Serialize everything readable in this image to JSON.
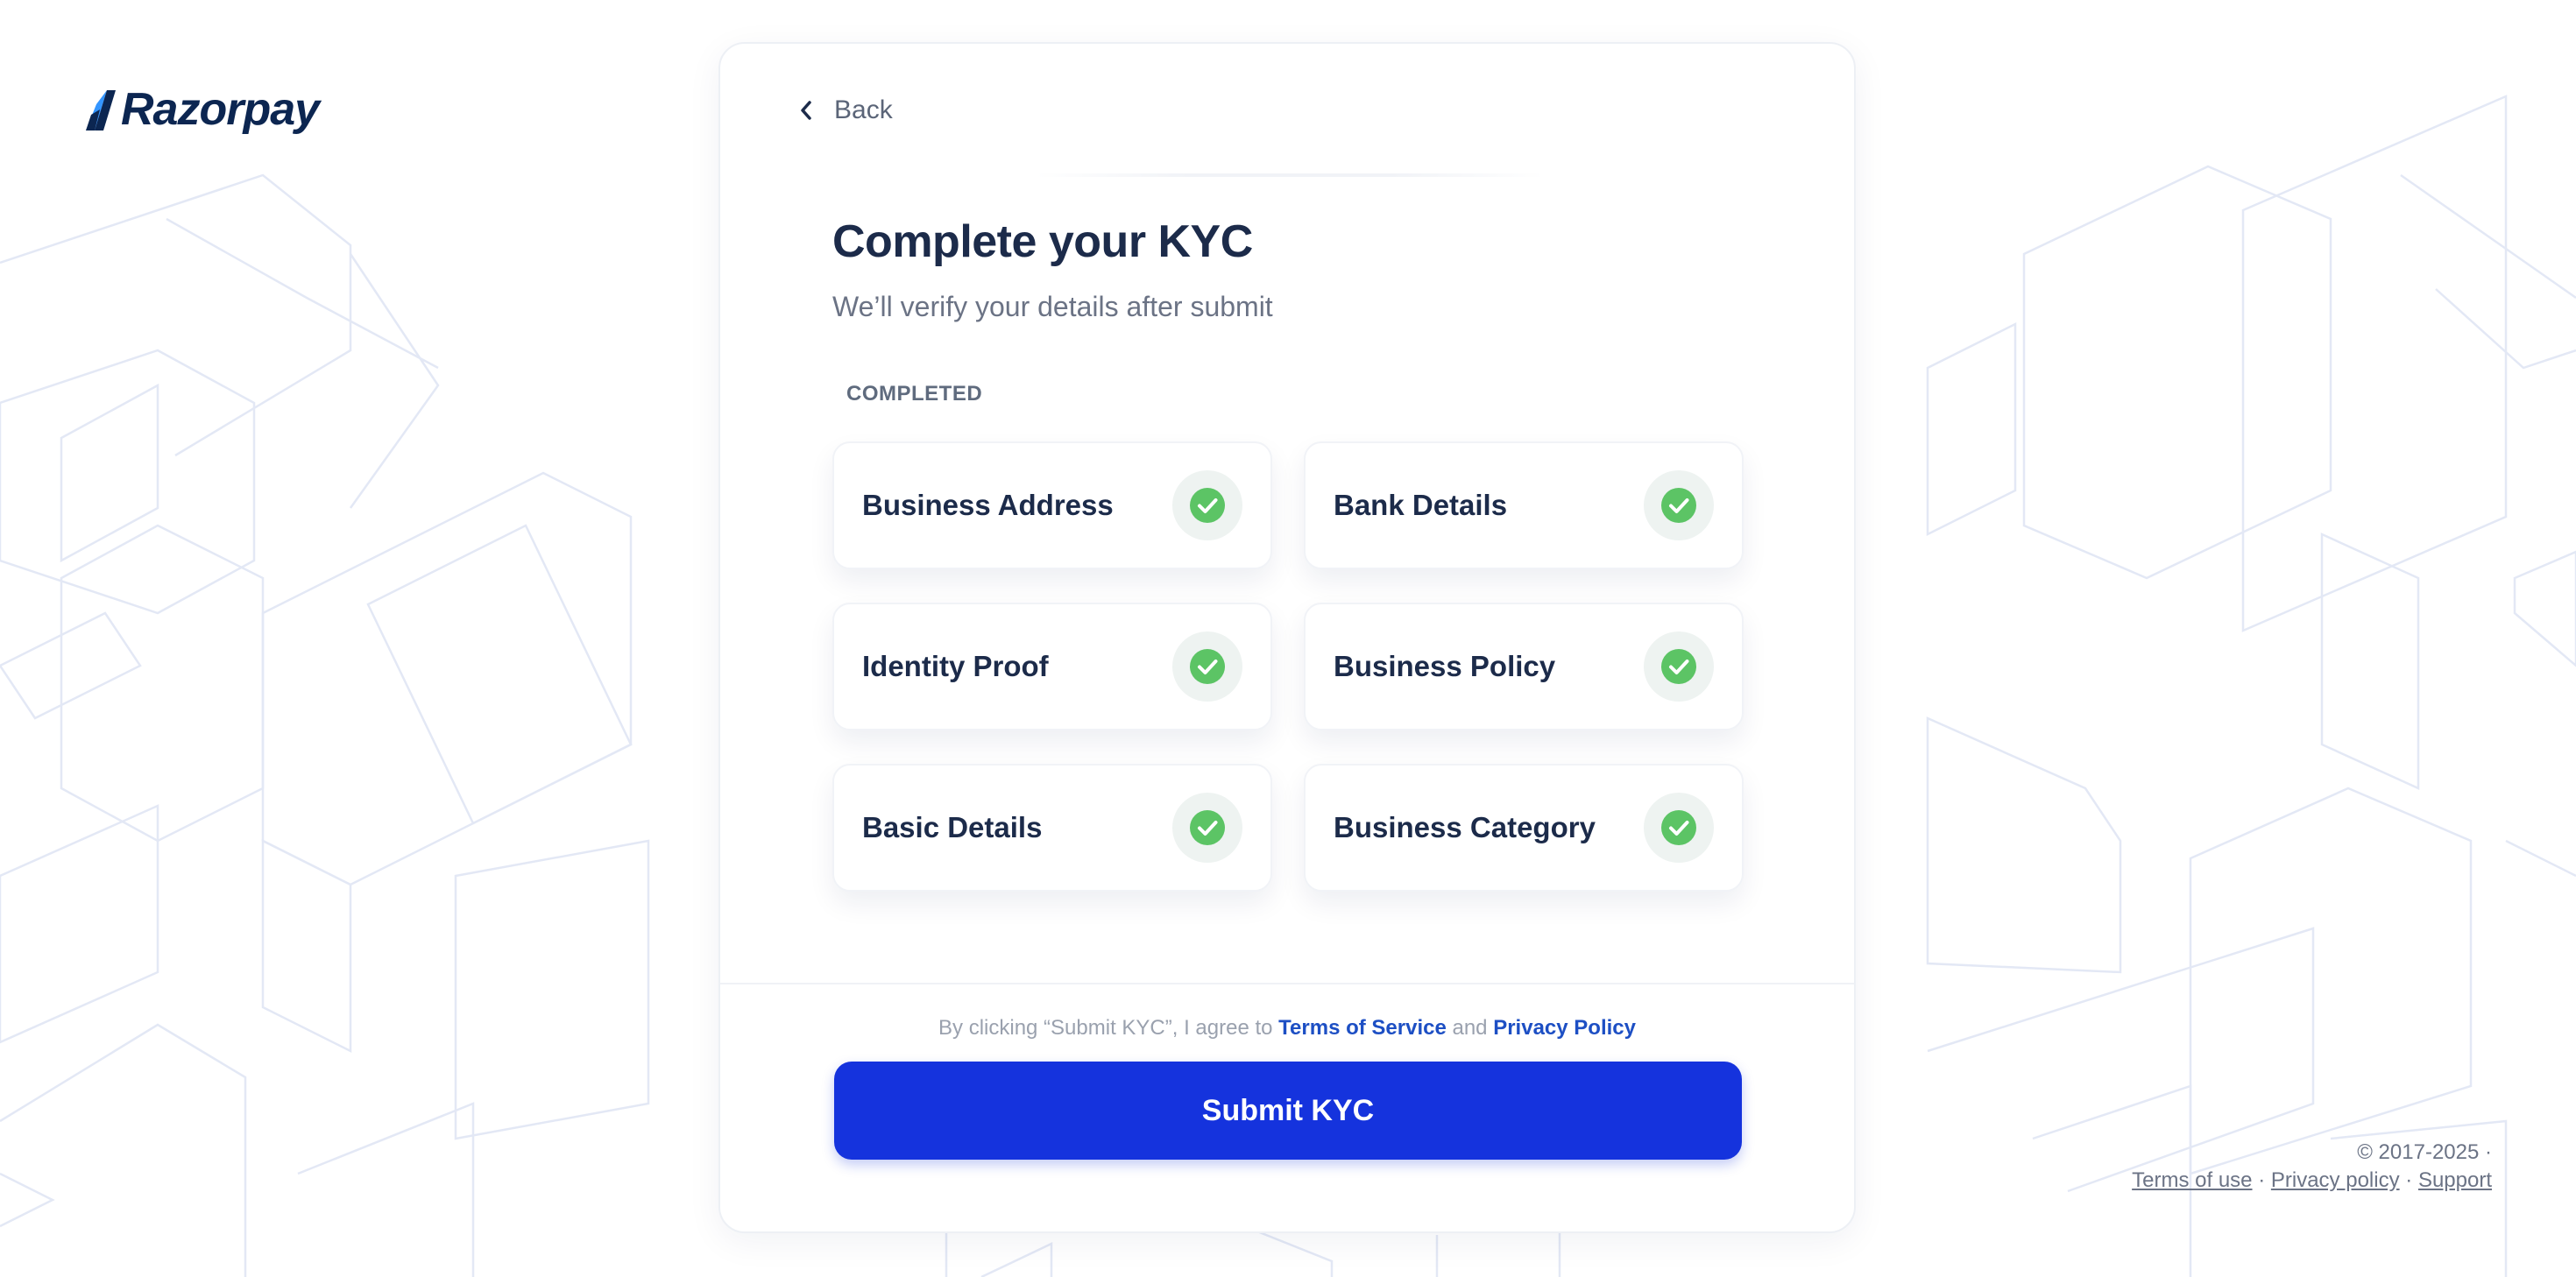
{
  "brand": {
    "name": "Razorpay",
    "color": "#0c2651",
    "accent": "#3395ff"
  },
  "back": {
    "label": "Back"
  },
  "header": {
    "title": "Complete your KYC",
    "subtitle": "We’ll verify your details after submit"
  },
  "section": {
    "label": "COMPLETED"
  },
  "steps": [
    {
      "label": "Business Address",
      "status": "completed",
      "icon": "check-circle-icon"
    },
    {
      "label": "Bank Details",
      "status": "completed",
      "icon": "check-circle-icon"
    },
    {
      "label": "Identity Proof",
      "status": "completed",
      "icon": "check-circle-icon"
    },
    {
      "label": "Business Policy",
      "status": "completed",
      "icon": "check-circle-icon"
    },
    {
      "label": "Basic Details",
      "status": "completed",
      "icon": "check-circle-icon"
    },
    {
      "label": "Business Category",
      "status": "completed",
      "icon": "check-circle-icon"
    }
  ],
  "agreement": {
    "prefix": "By clicking “Submit KYC”, I agree to",
    "terms": "Terms of Service",
    "connector": "and",
    "privacy": "Privacy Policy"
  },
  "submit": {
    "label": "Submit KYC",
    "color": "#1533dd"
  },
  "footer": {
    "copyright": "© 2017-2025 ·",
    "links": [
      "Terms of use",
      "Privacy policy",
      "Support"
    ],
    "separator": "·"
  },
  "colors": {
    "success": "#5cc465",
    "link": "#1d4fc4",
    "title": "#1c2b4a"
  }
}
